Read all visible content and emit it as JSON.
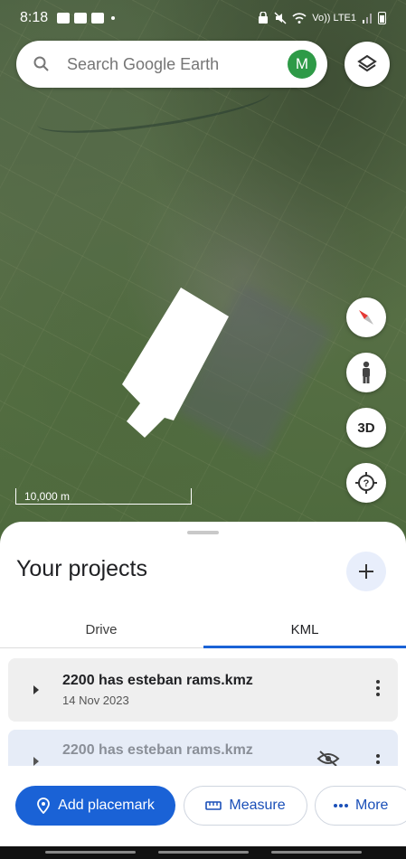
{
  "status_bar": {
    "time": "8:18",
    "network": "Vo)) LTE1"
  },
  "search": {
    "placeholder": "Search Google Earth",
    "avatar_letter": "M"
  },
  "map": {
    "scale_label": "10,000 m",
    "btn_3d": "3D"
  },
  "sheet": {
    "title": "Your projects",
    "tabs": [
      {
        "label": "Drive",
        "selected": false
      },
      {
        "label": "KML",
        "selected": true
      }
    ],
    "items": [
      {
        "name": "2200 has esteban rams.kmz",
        "date": "14 Nov 2023",
        "hidden": false
      },
      {
        "name": "2200 has esteban rams.kmz",
        "hidden": true
      }
    ]
  },
  "actions": {
    "add_placemark": "Add placemark",
    "measure": "Measure",
    "more": "More"
  },
  "colors": {
    "accent": "#1a62d6",
    "avatar": "#2e9a47"
  }
}
